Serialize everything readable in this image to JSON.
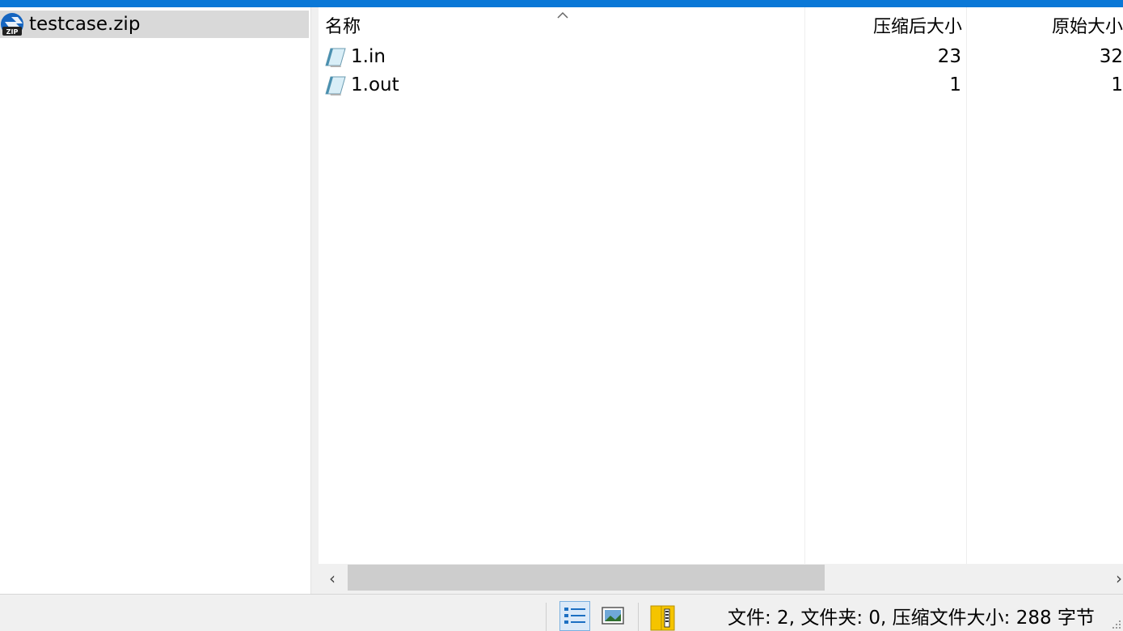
{
  "tree": {
    "archive_name": "testcase.zip",
    "icon": "zip-archive-icon"
  },
  "list": {
    "columns": {
      "name": "名称",
      "compressed": "压缩后大小",
      "original": "原始大小"
    },
    "sort_icon": "chevron-up-icon",
    "files": [
      {
        "name": "1.in",
        "compressed": "23",
        "original": "32",
        "icon": "text-file-icon"
      },
      {
        "name": "1.out",
        "compressed": "1",
        "original": "1",
        "icon": "text-file-icon"
      }
    ]
  },
  "scrollbar": {
    "left_arrow": "‹",
    "right_arrow": "›"
  },
  "statusbar": {
    "text": "文件: 2, 文件夹: 0, 压缩文件大小: 288 字节",
    "buttons": [
      "details-view-icon",
      "preview-icon",
      "zip-book-icon"
    ]
  },
  "colors": {
    "accent": "#0a78d7",
    "selection": "#d9d9d9",
    "statusbar": "#f0f0f0"
  }
}
